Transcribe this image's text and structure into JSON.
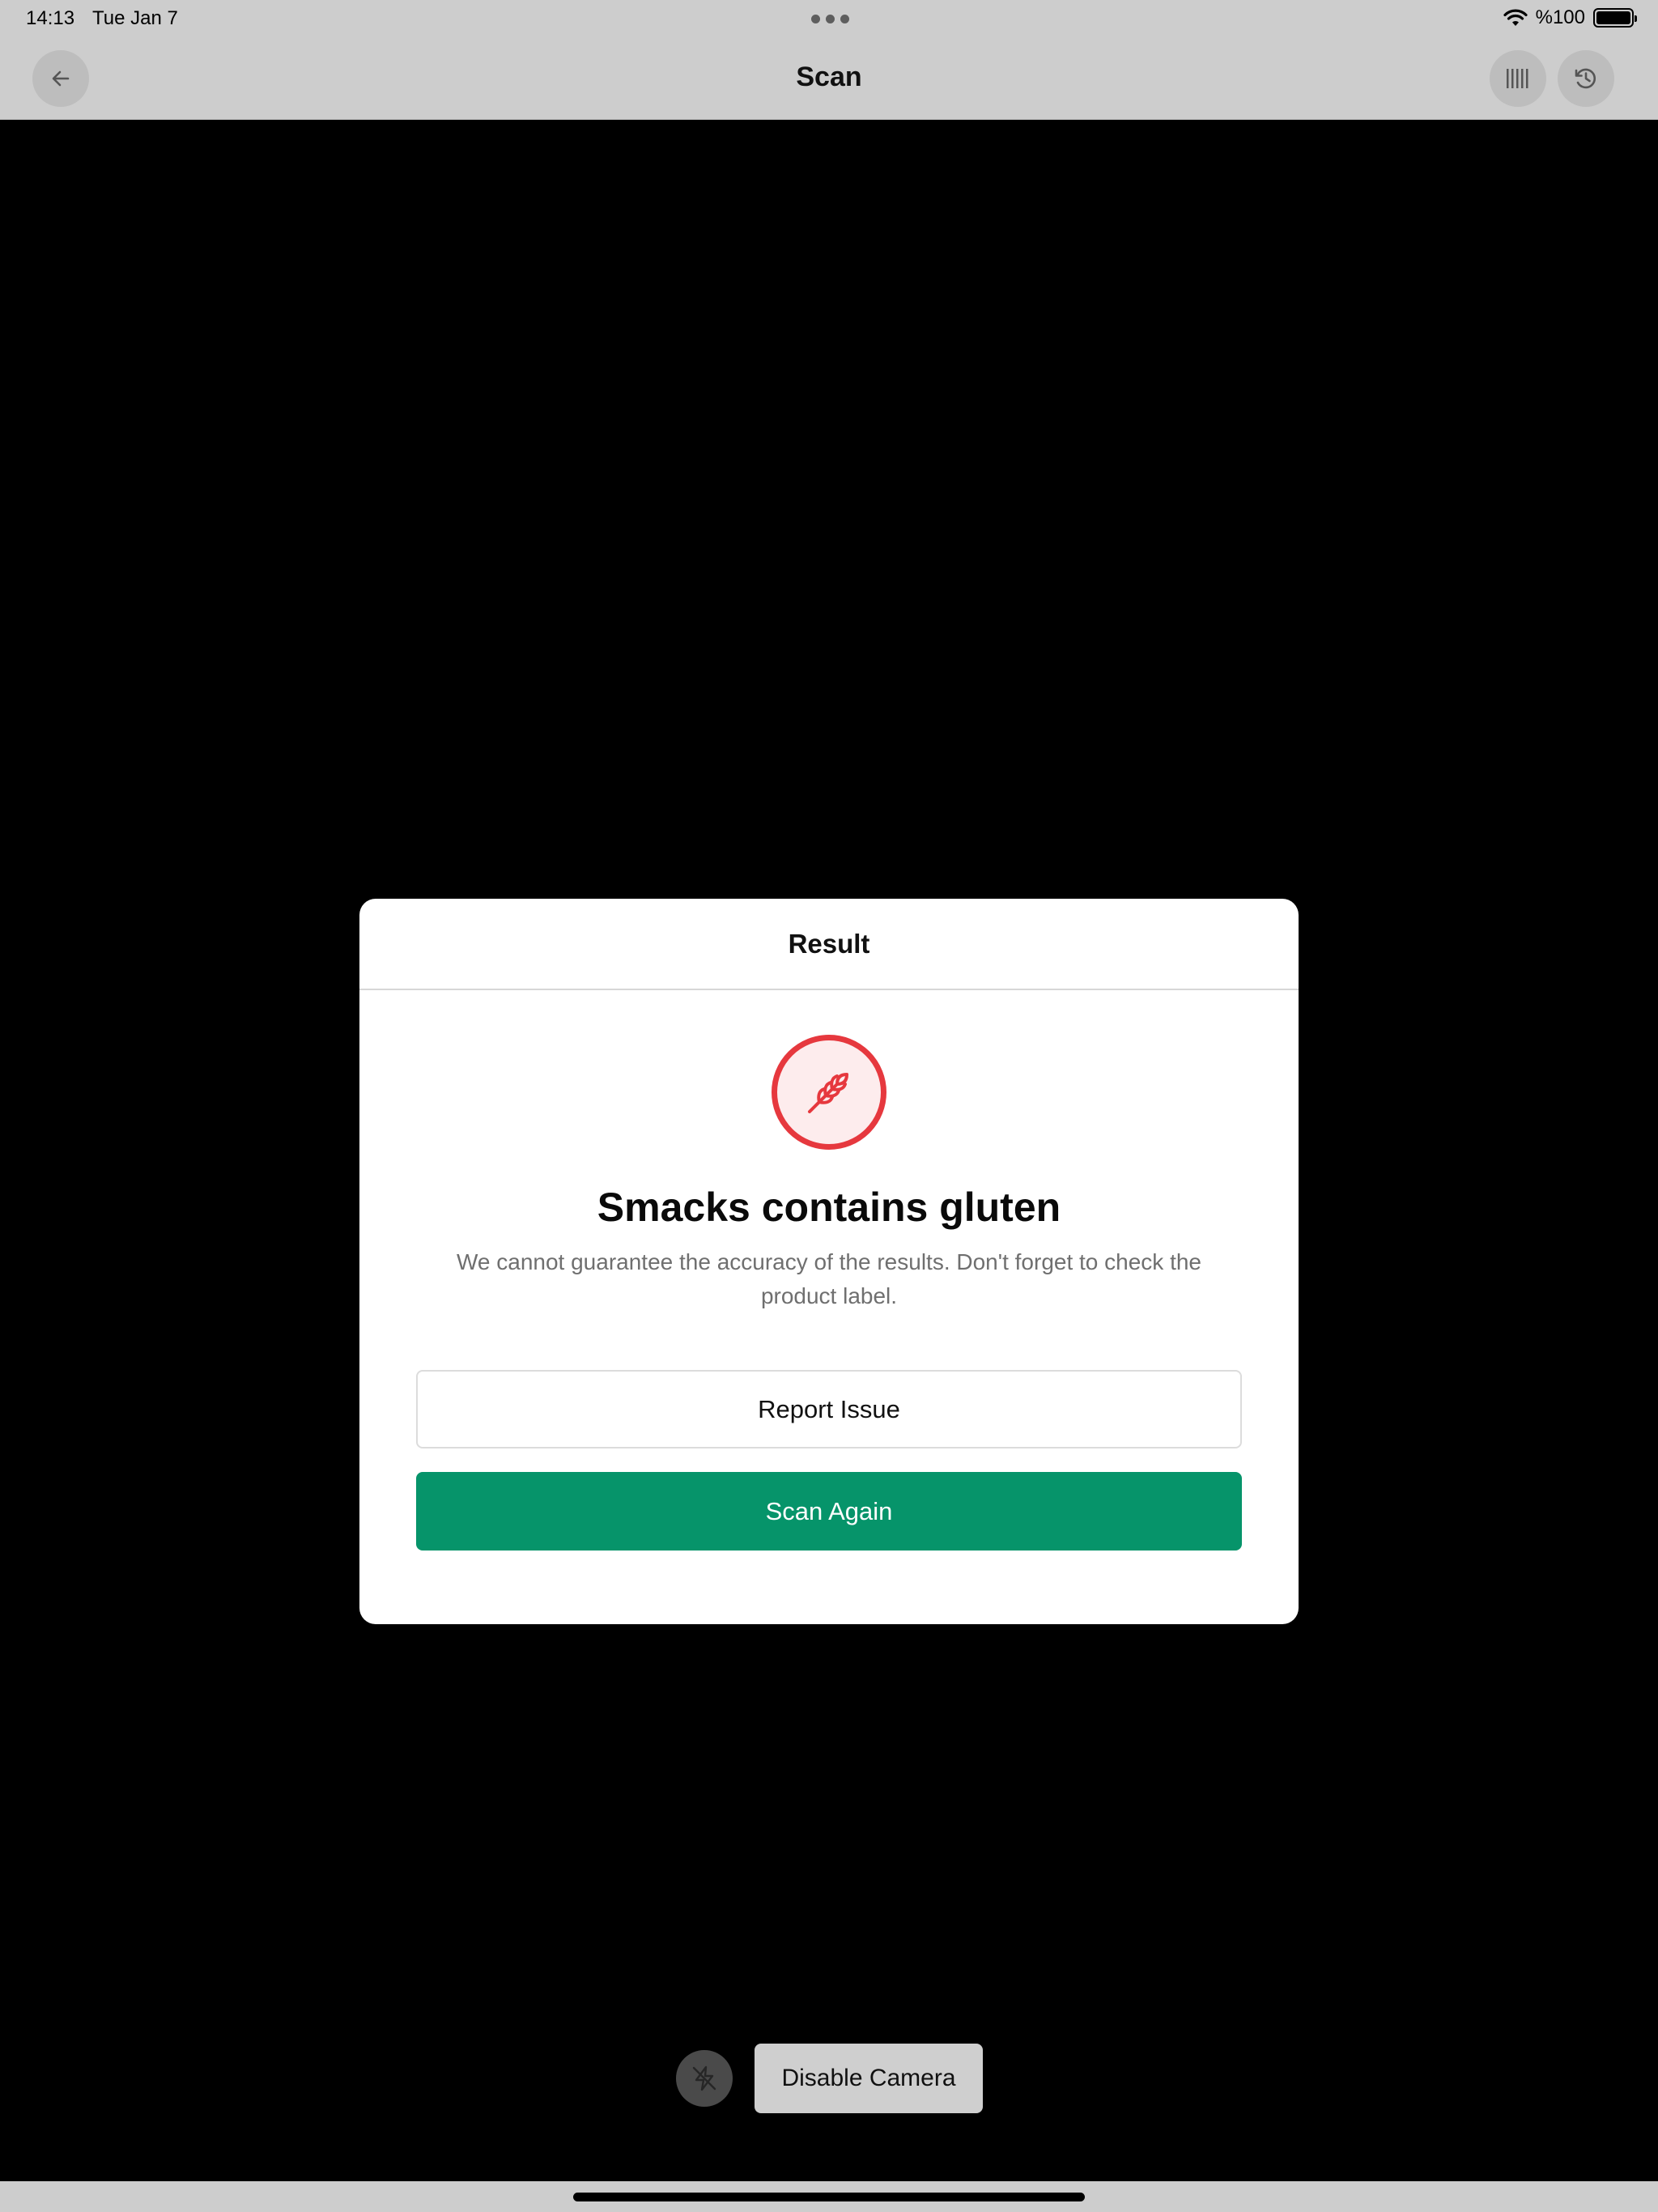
{
  "status_bar": {
    "time": "14:13",
    "date": "Tue Jan 7",
    "battery": "%100",
    "icons": [
      "wifi-icon",
      "battery-icon"
    ]
  },
  "nav": {
    "title": "Scan",
    "left_icon": "back-arrow-icon",
    "right_icons": [
      "barcode-icon",
      "history-icon"
    ]
  },
  "modal": {
    "header": "Result",
    "icon": "gluten-wheat-icon",
    "title": "Smacks contains gluten",
    "description": "We cannot guarantee the accuracy of the results. Don't forget to check the product label.",
    "report_label": "Report Issue",
    "scan_again_label": "Scan Again"
  },
  "camera_controls": {
    "flash_icon": "flash-off-icon",
    "disable_camera_label": "Disable Camera"
  },
  "colors": {
    "accent_green": "#06946a",
    "alert_red": "#e6383e",
    "alert_red_bg": "#fdeced"
  }
}
